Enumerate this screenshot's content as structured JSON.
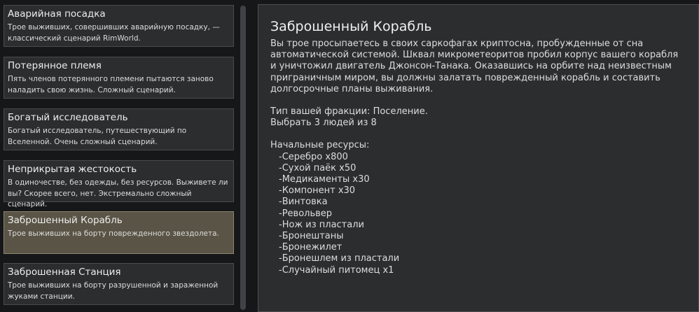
{
  "scenarios": [
    {
      "title": "Аварийная посадка",
      "desc": "Трое выживших, совершивших аварийную посадку, — классический сценарий RimWorld."
    },
    {
      "title": "Потерянное племя",
      "desc": "Пять членов потерянного племени пытаются заново наладить свою жизнь. Сложный сценарий."
    },
    {
      "title": "Богатый исследователь",
      "desc": "Богатый исследователь, путешествующий по Вселенной. Очень сложный сценарий."
    },
    {
      "title": "Неприкрытая жестокость",
      "desc": "В одиночестве, без одежды, без ресурсов. Выживете ли вы? Скорее всего, нет. Экстремально сложный сценарий."
    },
    {
      "title": "Заброшенный Корабль",
      "desc": "Трое выживших на борту поврежденного звездолета."
    },
    {
      "title": "Заброшенная Станция",
      "desc": "Трое выживших на борту разрушенной и зараженной жуками станции."
    }
  ],
  "selected_index": 4,
  "detail": {
    "title": "Заброшенный Корабль",
    "description": "Вы трое просыпаетесь в своих саркофагах криптосна, пробужденные от сна автоматической системой. Шквал микрометеоритов пробил корпус вашего корабля и уничтожил двигатель Джонсон-Танака. Оказавшись на орбите над неизвестным приграничным миром, вы должны залатать поврежденный корабль и составить долгосрочные планы выживания.",
    "faction": "Тип вашей фракции: Поселение.",
    "pick": "Выбрать 3 людей из 8",
    "resources_header": "Начальные ресурсы:",
    "resources": [
      "-Серебро x800",
      "-Сухой паёк x50",
      "-Медикаменты x30",
      "-Компонент x30",
      "-Винтовка",
      "-Револьвер",
      "-Нож из пластали",
      "-Бронештаны",
      "-Бронежилет",
      "-Бронешлем из пластали",
      "-Случайный питомец x1"
    ]
  }
}
